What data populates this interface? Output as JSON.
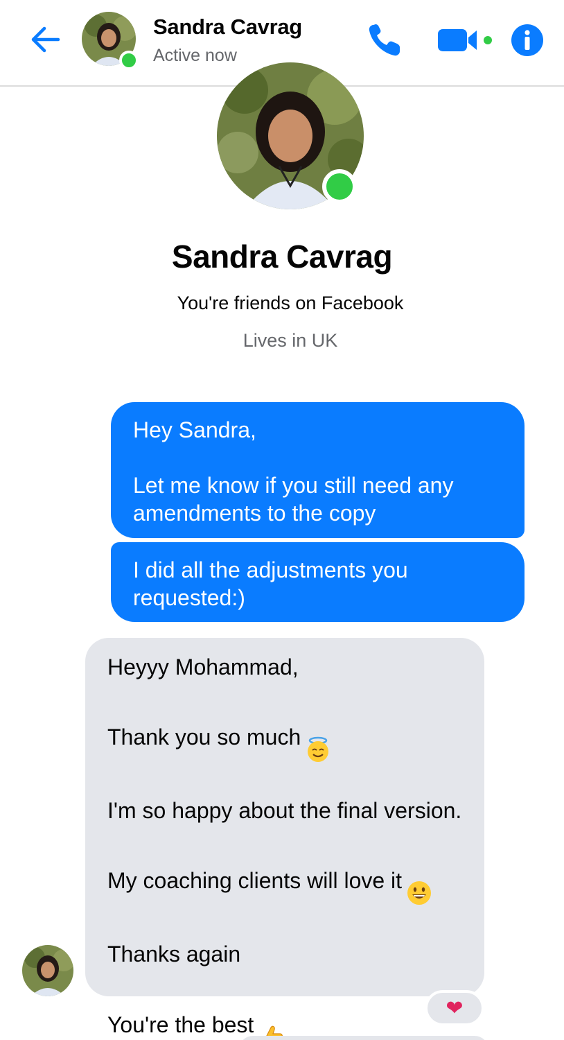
{
  "header": {
    "contact_name": "Sandra Cavrag",
    "status": "Active now",
    "icons": [
      "back-arrow-icon",
      "phone-icon",
      "video-camera-icon",
      "info-icon"
    ]
  },
  "profile": {
    "name": "Sandra Cavrag",
    "friendship": "You're friends on Facebook",
    "location": "Lives in UK"
  },
  "messages": {
    "outgoing_1": {
      "line_1": "Hey Sandra,",
      "line_2": "Let me know if you still need any amendments to the copy"
    },
    "outgoing_2": {
      "text": "I did all the adjustments you requested:)"
    },
    "incoming_1": {
      "line_1": "Heyyy Mohammad,",
      "line_2": "Thank you so much",
      "line_3": "I'm so happy about the final version.",
      "line_4": "My coaching clients will love it",
      "line_5": "Thanks again",
      "line_6": "You're the best"
    },
    "reaction": "❤"
  },
  "colors": {
    "accent": "#0a7cff",
    "online": "#31cc46",
    "incoming_bubble": "#e4e6eb",
    "secondary_text": "#65676b"
  }
}
